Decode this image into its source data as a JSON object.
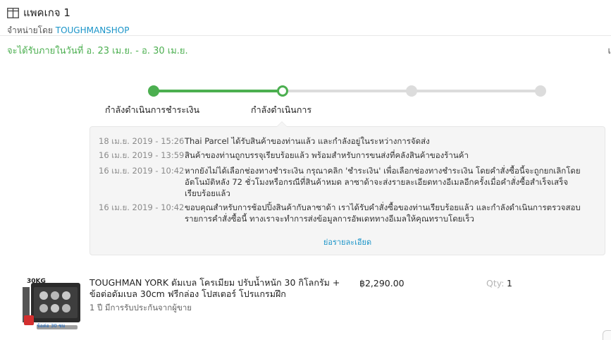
{
  "package": {
    "title": "แพคเกจ 1",
    "seller_prefix": "จำหน่ายโดย",
    "seller_name": "TOUGHMANSHOP",
    "icon": "package-icon"
  },
  "delivery": {
    "eta": "จะได้รับภายในวันที่ อ. 23 เม.ย. - อ. 30 เม.ย.",
    "edge_mark": "เ"
  },
  "progress": {
    "steps": [
      {
        "label": "กำลังดำเนินการชำระเงิน",
        "state": "done"
      },
      {
        "label": "กำลังดำเนินการ",
        "state": "current"
      },
      {
        "label": "",
        "state": "todo"
      },
      {
        "label": "",
        "state": "todo"
      }
    ]
  },
  "tracking": {
    "entries": [
      {
        "time": "18 เม.ย. 2019 - 15:26",
        "message": "Thai Parcel ได้รับสินค้าของท่านแล้ว และกำลังอยู่ในระหว่างการจัดส่ง"
      },
      {
        "time": "16 เม.ย. 2019 - 13:59",
        "message": "สินค้าของท่านถูกบรรจุเรียบร้อยแล้ว พร้อมสำหรับการขนส่งที่คลังสินค้าของร้านค้า"
      },
      {
        "time": "16 เม.ย. 2019 - 10:42",
        "message": "หากยังไม่ได้เลือกช่องทางชำระเงิน กรุณาคลิก 'ชำระเงิน' เพื่อเลือกช่องทางชำระเงิน โดยคำสั่งซื้อนี้จะถูกยกเลิกโดยอัตโนมัติหลัง 72 ชั่วโมงหรือกรณีที่สินค้าหมด ลาซาด้าจะส่งรายละเอียดทางอีเมลอีกครั้งเมื่อคำสั่งซื้อสำเร็จเสร็จเรียบร้อยแล้ว"
      },
      {
        "time": "16 เม.ย. 2019 - 10:42",
        "message": "ขอบคุณสำหรับการช้อปปิ้งสินค้ากับลาซาด้า เราได้รับคำสั่งซื้อของท่านเรียบร้อยแล้ว และกำลังดำเนินการตรวจสอบรายการคำสั่งซื้อนี้ ทางเราจะทำการส่งข้อมูลการอัพเดททางอีเมลให้คุณทราบโดยเร็ว"
      }
    ],
    "more_link": "ย่อรายละเอียด"
  },
  "item": {
    "name": "TOUGHMAN YORK ดัมเบล โครเมียม ปรับน้ำหนัก 30 กิโลกรัม + ข้อต่อดัมเบล 30cm ฟรีกล่อง โปสเตอร์ โปรแกรมฝึก",
    "warranty": "1 ปี มีการรับประกันจากผู้ขาย",
    "price": "฿2,290.00",
    "qty_label": "Qty:",
    "qty": "1",
    "thumb_badge": "30KG",
    "thumb_caption": "ข้อต่อ 30 ซม"
  },
  "colors": {
    "accent_green": "#4caf50",
    "link_blue": "#1a94c8",
    "inactive_gray": "#dcdcdc"
  }
}
